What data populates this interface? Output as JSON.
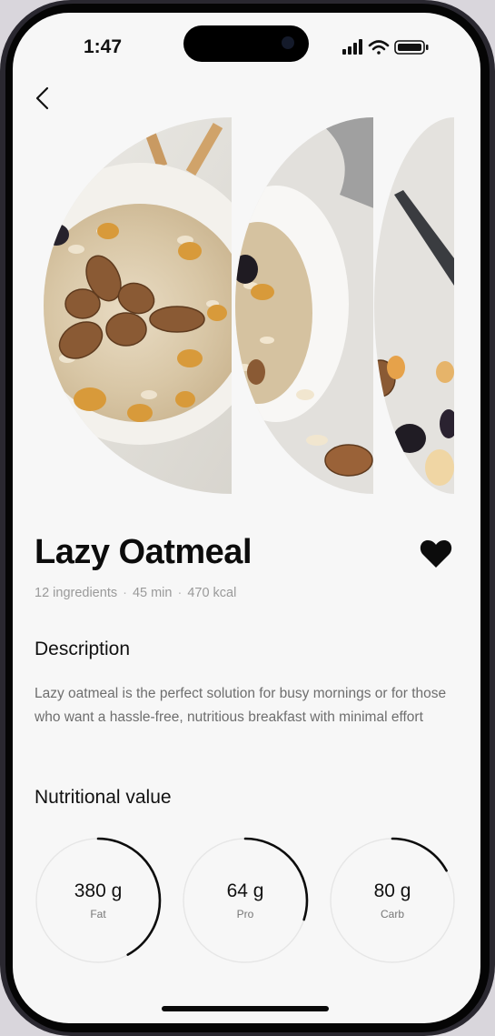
{
  "status_bar": {
    "time": "1:47"
  },
  "recipe": {
    "title": "Lazy Oatmeal",
    "ingredients": "12 ingredients",
    "time": "45 min",
    "calories": "470 kcal",
    "separator": "·",
    "favorite": true
  },
  "description": {
    "heading": "Description",
    "text": "Lazy oatmeal is the perfect solution for busy mornings or for those who want a hassle-free, nutritious breakfast with minimal effort"
  },
  "nutrition": {
    "heading": "Nutritional value",
    "items": [
      {
        "value": "380 g",
        "label": "Fat",
        "progress": 0.42
      },
      {
        "value": "64 g",
        "label": "Pro",
        "progress": 0.3
      },
      {
        "value": "80 g",
        "label": "Carb",
        "progress": 0.17
      }
    ]
  },
  "colors": {
    "accent": "#0c0c0c",
    "background": "#f7f7f7",
    "muted_text": "#9a9a9a"
  },
  "icons": {
    "back": "chevron-left-icon",
    "favorite": "heart-icon"
  }
}
